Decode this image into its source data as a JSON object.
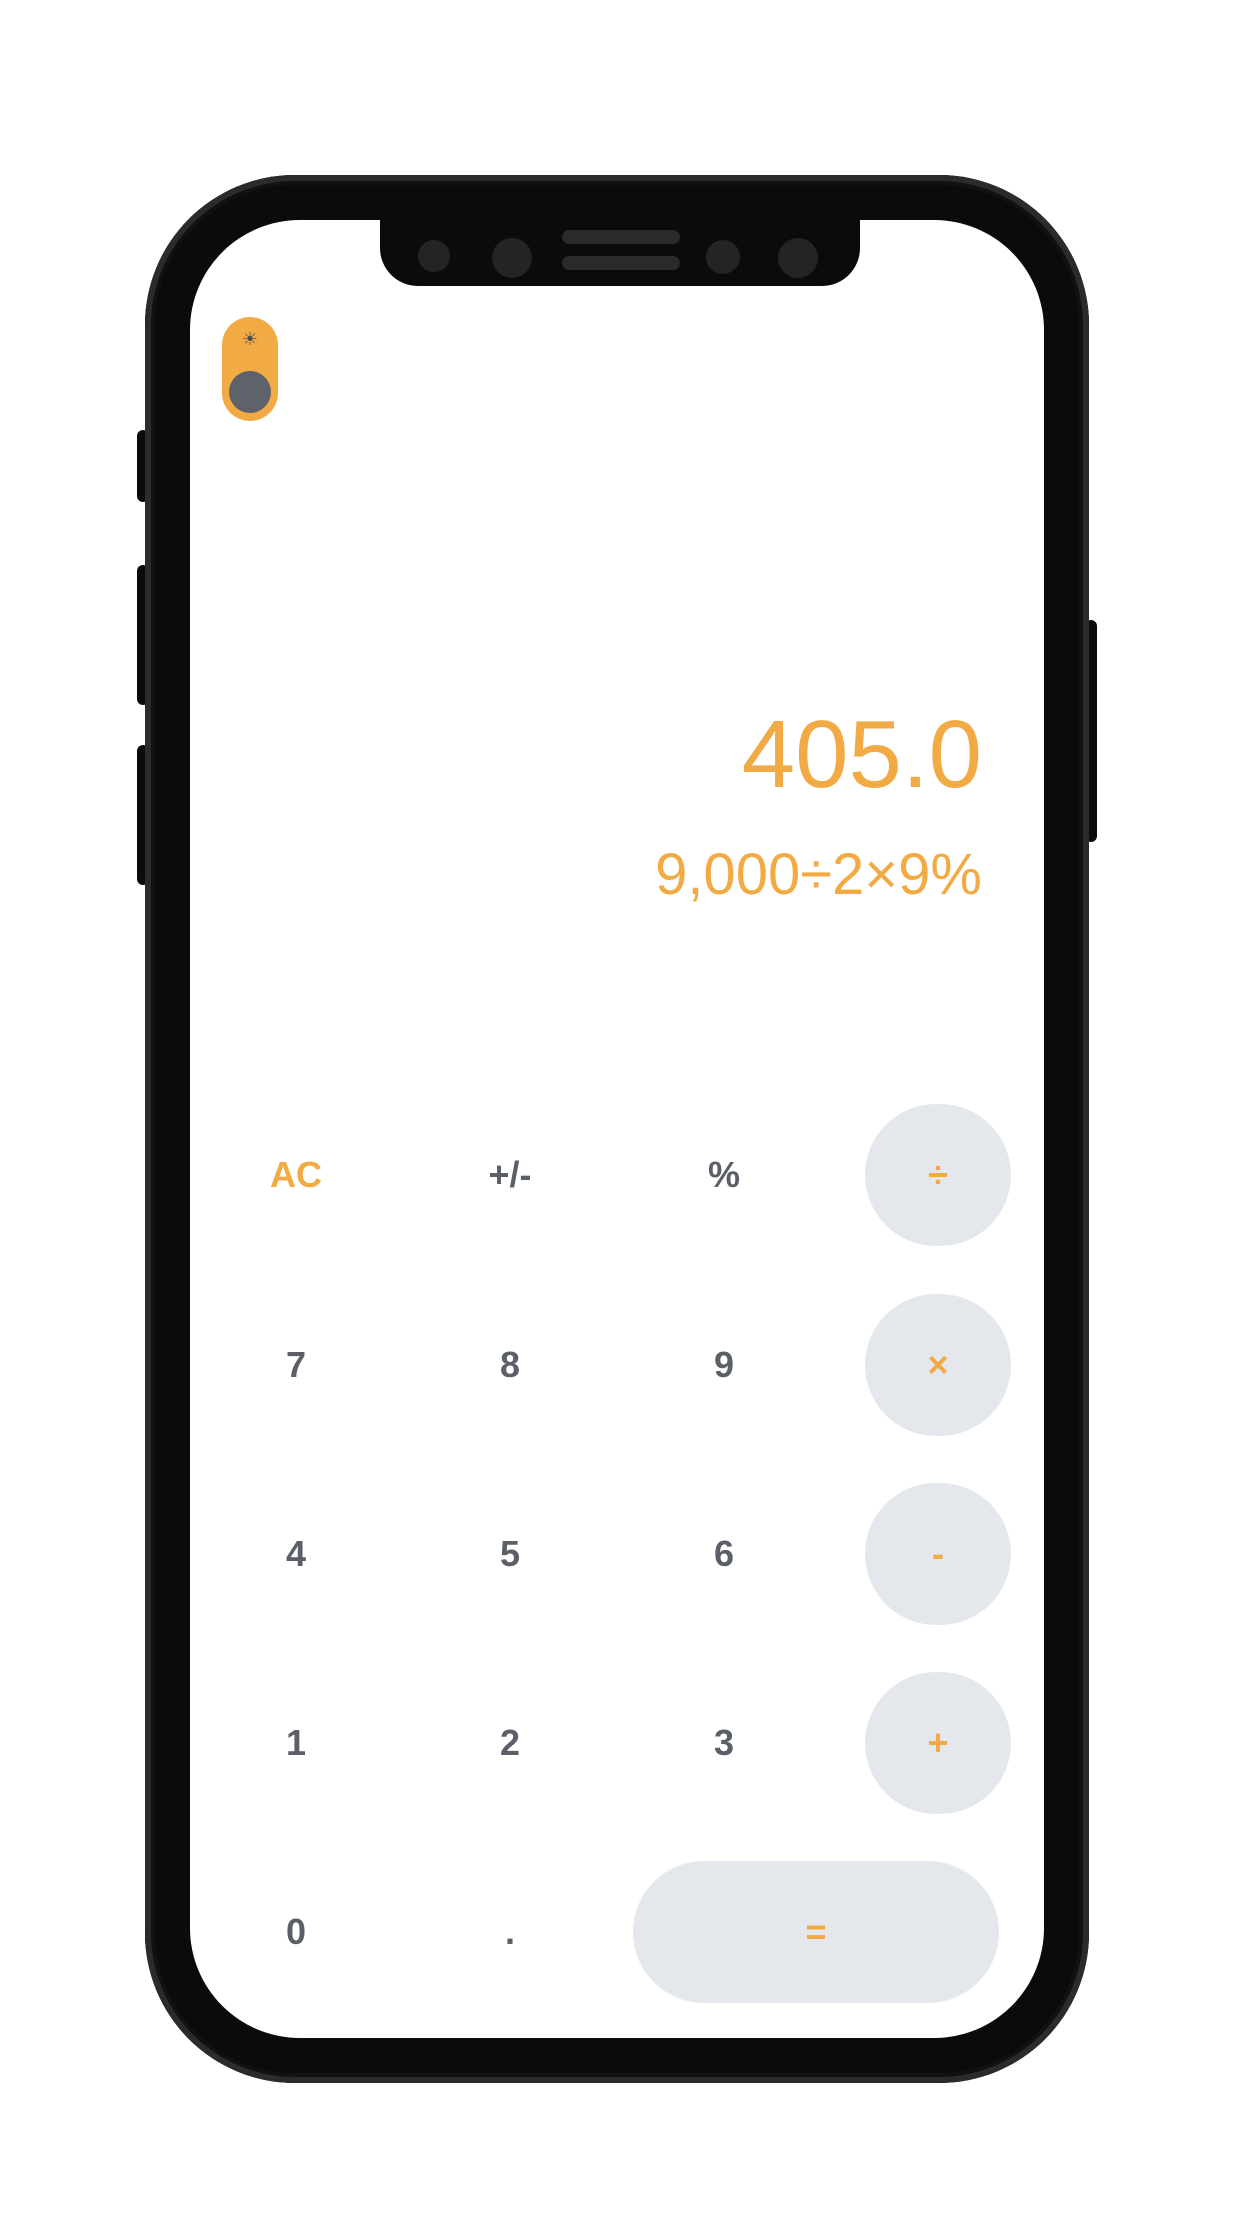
{
  "theme_toggle": {
    "icon": "sun-icon",
    "glyph": "☀",
    "state": "light",
    "accent": "#f2ab44",
    "knob_color": "#5e626a"
  },
  "display": {
    "result": "405.0",
    "expression": "9,000÷2×9%",
    "color": "#f2ab44"
  },
  "keys": {
    "clear": "AC",
    "negate": "+/-",
    "percent": "%",
    "divide": "÷",
    "seven": "7",
    "eight": "8",
    "nine": "9",
    "multiply": "×",
    "four": "4",
    "five": "5",
    "six": "6",
    "subtract": "-",
    "one": "1",
    "two": "2",
    "three": "3",
    "add": "+",
    "zero": "0",
    "decimal": ".",
    "equals": "="
  },
  "colors": {
    "accent": "#f2ab44",
    "key_text": "#5b5f67",
    "operator_bg": "#e4e8ec"
  }
}
